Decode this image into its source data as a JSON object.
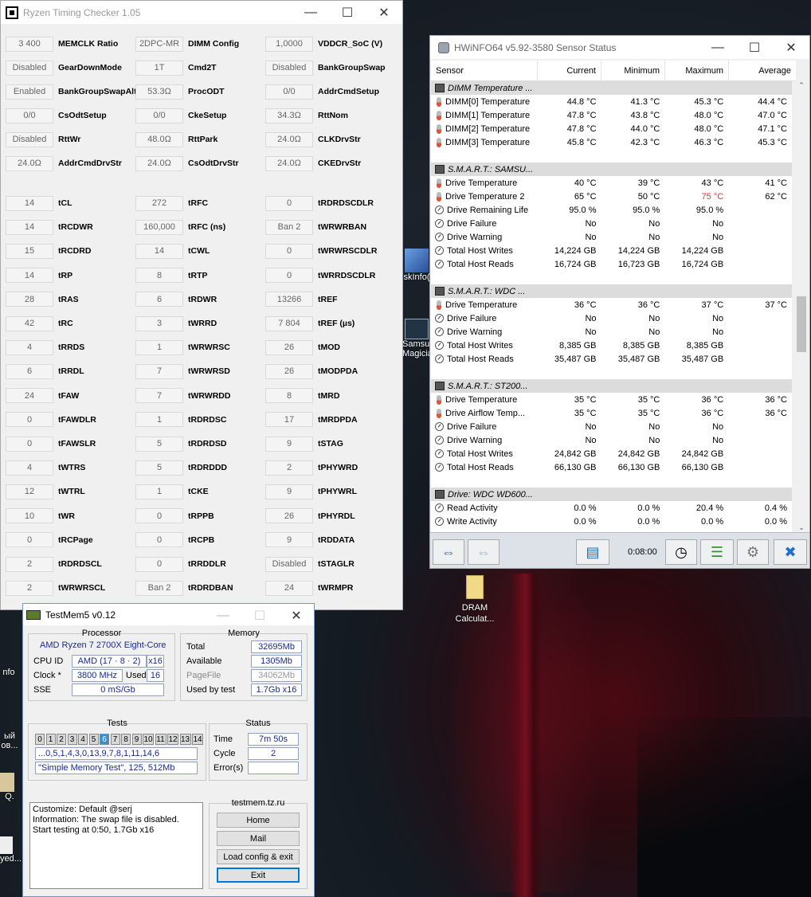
{
  "rtc": {
    "title": "Ryzen Timing Checker 1.05",
    "rows": [
      [
        [
          "3 400",
          "MEMCLK Ratio"
        ],
        [
          "2DPC-MR",
          "DIMM Config"
        ],
        [
          "1,0000",
          "VDDCR_SoC (V)"
        ]
      ],
      [
        [
          "Disabled",
          "GearDownMode"
        ],
        [
          "1T",
          "Cmd2T"
        ],
        [
          "Disabled",
          "BankGroupSwap"
        ]
      ],
      [
        [
          "Enabled",
          "BankGroupSwapAlt"
        ],
        [
          "53.3Ω",
          "ProcODT"
        ],
        [
          "0/0",
          "AddrCmdSetup"
        ]
      ],
      [
        [
          "0/0",
          "CsOdtSetup"
        ],
        [
          "0/0",
          "CkeSetup"
        ],
        [
          "34.3Ω",
          "RttNom"
        ]
      ],
      [
        [
          "Disabled",
          "RttWr"
        ],
        [
          "48.0Ω",
          "RttPark"
        ],
        [
          "24.0Ω",
          "CLKDrvStr"
        ]
      ],
      [
        [
          "24.0Ω",
          "AddrCmdDrvStr"
        ],
        [
          "24.0Ω",
          "CsOdtDrvStr"
        ],
        [
          "24.0Ω",
          "CKEDrvStr"
        ]
      ]
    ],
    "timings": [
      [
        [
          "14",
          "tCL"
        ],
        [
          "272",
          "tRFC"
        ],
        [
          "0",
          "tRDRDSCDLR"
        ]
      ],
      [
        [
          "14",
          "tRCDWR"
        ],
        [
          "160,000",
          "tRFC (ns)"
        ],
        [
          "Ban 2",
          "tWRWRBAN"
        ]
      ],
      [
        [
          "15",
          "tRCDRD"
        ],
        [
          "14",
          "tCWL"
        ],
        [
          "0",
          "tWRWRSCDLR"
        ]
      ],
      [
        [
          "14",
          "tRP"
        ],
        [
          "8",
          "tRTP"
        ],
        [
          "0",
          "tWRRDSCDLR"
        ]
      ],
      [
        [
          "28",
          "tRAS"
        ],
        [
          "6",
          "tRDWR"
        ],
        [
          "13266",
          "tREF"
        ]
      ],
      [
        [
          "42",
          "tRC"
        ],
        [
          "3",
          "tWRRD"
        ],
        [
          "7 804",
          "tREF (µs)"
        ]
      ],
      [
        [
          "4",
          "tRRDS"
        ],
        [
          "1",
          "tWRWRSC"
        ],
        [
          "26",
          "tMOD"
        ]
      ],
      [
        [
          "6",
          "tRRDL"
        ],
        [
          "7",
          "tWRWRSD"
        ],
        [
          "26",
          "tMODPDA"
        ]
      ],
      [
        [
          "24",
          "tFAW"
        ],
        [
          "7",
          "tWRWRDD"
        ],
        [
          "8",
          "tMRD"
        ]
      ],
      [
        [
          "0",
          "tFAWDLR"
        ],
        [
          "1",
          "tRDRDSC"
        ],
        [
          "17",
          "tMRDPDA"
        ]
      ],
      [
        [
          "0",
          "tFAWSLR"
        ],
        [
          "5",
          "tRDRDSD"
        ],
        [
          "9",
          "tSTAG"
        ]
      ],
      [
        [
          "4",
          "tWTRS"
        ],
        [
          "5",
          "tRDRDDD"
        ],
        [
          "2",
          "tPHYWRD"
        ]
      ],
      [
        [
          "12",
          "tWTRL"
        ],
        [
          "1",
          "tCKE"
        ],
        [
          "9",
          "tPHYWRL"
        ]
      ],
      [
        [
          "10",
          "tWR"
        ],
        [
          "0",
          "tRPPB"
        ],
        [
          "26",
          "tPHYRDL"
        ]
      ],
      [
        [
          "0",
          "tRCPage"
        ],
        [
          "0",
          "tRCPB"
        ],
        [
          "9",
          "tRDDATA"
        ]
      ],
      [
        [
          "2",
          "tRDRDSCL"
        ],
        [
          "0",
          "tRRDDLR"
        ],
        [
          "Disabled",
          "tSTAGLR"
        ]
      ],
      [
        [
          "2",
          "tWRWRSCL"
        ],
        [
          "Ban 2",
          "tRDRDBAN"
        ],
        [
          "24",
          "tWRMPR"
        ]
      ]
    ]
  },
  "hw": {
    "title": "HWiNFO64 v5.92-3580 Sensor Status",
    "headers": [
      "Sensor",
      "Current",
      "Minimum",
      "Maximum",
      "Average"
    ],
    "rows": [
      {
        "g": 1,
        "ic": "chip",
        "n": "DIMM Temperature ..."
      },
      {
        "ic": "therm",
        "n": "DIMM[0] Temperature",
        "v": [
          "44.8 °C",
          "41.3 °C",
          "45.3 °C",
          "44.4 °C"
        ]
      },
      {
        "ic": "therm",
        "n": "DIMM[1] Temperature",
        "v": [
          "47.8 °C",
          "43.8 °C",
          "48.0 °C",
          "47.0 °C"
        ]
      },
      {
        "ic": "therm",
        "n": "DIMM[2] Temperature",
        "v": [
          "47.8 °C",
          "44.0 °C",
          "48.0 °C",
          "47.1 °C"
        ]
      },
      {
        "ic": "therm",
        "n": "DIMM[3] Temperature",
        "v": [
          "45.8 °C",
          "42.3 °C",
          "46.3 °C",
          "45.3 °C"
        ]
      },
      {
        "e": 1
      },
      {
        "g": 1,
        "ic": "chip",
        "n": "S.M.A.R.T.: SAMSU..."
      },
      {
        "ic": "therm",
        "n": "Drive Temperature",
        "v": [
          "40 °C",
          "39 °C",
          "43 °C",
          "41 °C"
        ]
      },
      {
        "ic": "therm",
        "n": "Drive Temperature 2",
        "v": [
          "65 °C",
          "50 °C",
          "75 °C",
          "62 °C"
        ],
        "red": 2
      },
      {
        "ic": "gauge",
        "n": "Drive Remaining Life",
        "v": [
          "95.0 %",
          "95.0 %",
          "95.0 %",
          ""
        ]
      },
      {
        "ic": "gauge",
        "n": "Drive Failure",
        "v": [
          "No",
          "No",
          "No",
          ""
        ]
      },
      {
        "ic": "gauge",
        "n": "Drive Warning",
        "v": [
          "No",
          "No",
          "No",
          ""
        ]
      },
      {
        "ic": "gauge",
        "n": "Total Host Writes",
        "v": [
          "14,224 GB",
          "14,224 GB",
          "14,224 GB",
          ""
        ]
      },
      {
        "ic": "gauge",
        "n": "Total Host Reads",
        "v": [
          "16,724 GB",
          "16,723 GB",
          "16,724 GB",
          ""
        ]
      },
      {
        "e": 1
      },
      {
        "g": 1,
        "ic": "chip",
        "n": "S.M.A.R.T.: WDC ..."
      },
      {
        "ic": "therm",
        "n": "Drive Temperature",
        "v": [
          "36 °C",
          "36 °C",
          "37 °C",
          "37 °C"
        ]
      },
      {
        "ic": "gauge",
        "n": "Drive Failure",
        "v": [
          "No",
          "No",
          "No",
          ""
        ]
      },
      {
        "ic": "gauge",
        "n": "Drive Warning",
        "v": [
          "No",
          "No",
          "No",
          ""
        ]
      },
      {
        "ic": "gauge",
        "n": "Total Host Writes",
        "v": [
          "8,385 GB",
          "8,385 GB",
          "8,385 GB",
          ""
        ]
      },
      {
        "ic": "gauge",
        "n": "Total Host Reads",
        "v": [
          "35,487 GB",
          "35,487 GB",
          "35,487 GB",
          ""
        ]
      },
      {
        "e": 1
      },
      {
        "g": 1,
        "ic": "chip",
        "n": "S.M.A.R.T.: ST200..."
      },
      {
        "ic": "therm",
        "n": "Drive Temperature",
        "v": [
          "35 °C",
          "35 °C",
          "36 °C",
          "36 °C"
        ]
      },
      {
        "ic": "therm",
        "n": "Drive Airflow Temp...",
        "v": [
          "35 °C",
          "35 °C",
          "36 °C",
          "36 °C"
        ]
      },
      {
        "ic": "gauge",
        "n": "Drive Failure",
        "v": [
          "No",
          "No",
          "No",
          ""
        ]
      },
      {
        "ic": "gauge",
        "n": "Drive Warning",
        "v": [
          "No",
          "No",
          "No",
          ""
        ]
      },
      {
        "ic": "gauge",
        "n": "Total Host Writes",
        "v": [
          "24,842 GB",
          "24,842 GB",
          "24,842 GB",
          ""
        ]
      },
      {
        "ic": "gauge",
        "n": "Total Host Reads",
        "v": [
          "66,130 GB",
          "66,130 GB",
          "66,130 GB",
          ""
        ]
      },
      {
        "e": 1
      },
      {
        "g": 1,
        "ic": "chip",
        "n": "Drive: WDC WD600..."
      },
      {
        "ic": "gauge",
        "n": "Read Activity",
        "v": [
          "0.0 %",
          "0.0 %",
          "20.4 %",
          "0.4 %"
        ]
      },
      {
        "ic": "gauge",
        "n": "Write Activity",
        "v": [
          "0.0 %",
          "0.0 %",
          "0.0 %",
          "0.0 %"
        ]
      }
    ],
    "timer": "0:08:00"
  },
  "tm": {
    "title": "TestMem5 v0.12",
    "processor_title": "Processor",
    "cpu_name": "AMD Ryzen 7 2700X Eight-Core",
    "cpu_id_label": "CPU ID",
    "cpu_id": "AMD  (17 · 8 · 2)",
    "cpu_threads": "x16",
    "clock_label": "Clock *",
    "clock": "3800 MHz",
    "used_label": "Used",
    "used": "16",
    "sse_label": "SSE",
    "sse": "0 mS/Gb",
    "memory_title": "Memory",
    "total_label": "Total",
    "total": "32695Mb",
    "avail_label": "Available",
    "avail": "1305Mb",
    "pagefile_label": "PageFile",
    "pagefile": "34062Mb",
    "usedby_label": "Used by test",
    "usedby": "1.7Gb x16",
    "tests_title": "Tests",
    "tests": [
      "0",
      "1",
      "2",
      "3",
      "4",
      "5",
      "6",
      "7",
      "8",
      "9",
      "10",
      "11",
      "12",
      "13",
      "14"
    ],
    "active_test": 6,
    "sequence": "...0,5,1,4,3,0,13,9,7,8,1,11,14,6",
    "current_test": "\"Simple Memory Test\", 125, 512Mb",
    "status_title": "Status",
    "time_label": "Time",
    "time": "7m 50s",
    "cycle_label": "Cycle",
    "cycle": "2",
    "errors_label": "Error(s)",
    "errors": "",
    "log": [
      "Customize: Default @serj",
      "Information: The swap file is disabled.",
      "Start testing at 0:50, 1.7Gb x16"
    ],
    "site_title": "testmem.tz.ru",
    "btn_home": "Home",
    "btn_mail": "Mail",
    "btn_load": "Load config & exit",
    "btn_exit": "Exit"
  },
  "desktop": {
    "icons": [
      "skInfo(",
      "Samsun\nMagicia",
      "DRAM\nCalculat...",
      "nfo",
      "ый\nов...",
      "Q.",
      "yed..."
    ]
  },
  "colors": {
    "accent": "#0078d7",
    "red_value": "#e0342a",
    "test_active": "#2f90e0"
  }
}
